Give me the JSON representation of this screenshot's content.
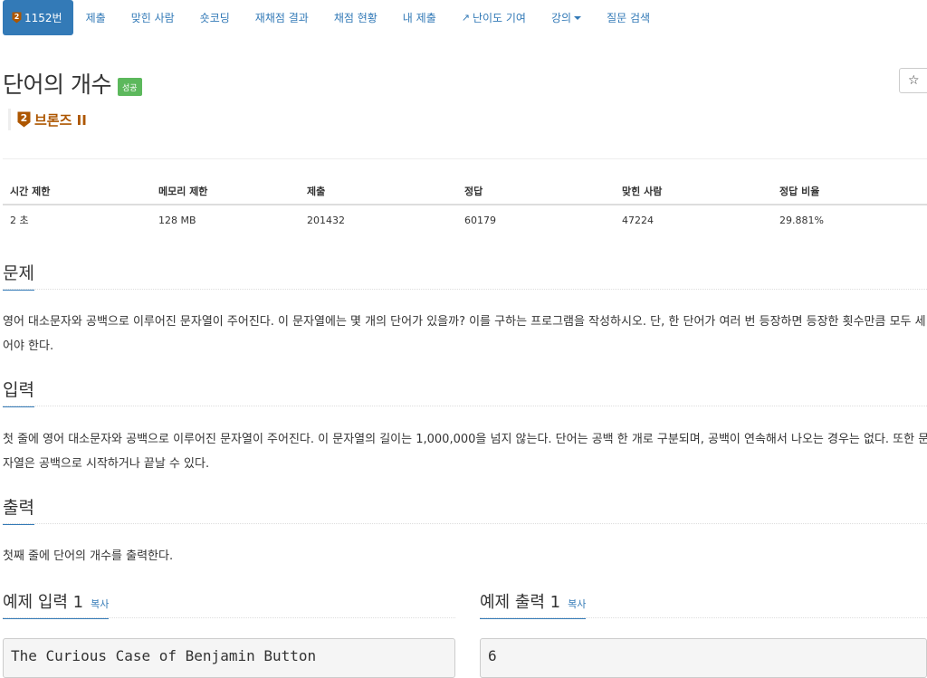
{
  "nav": {
    "tabs": [
      {
        "label": "1152번",
        "active": true
      },
      {
        "label": "제출"
      },
      {
        "label": "맞힌 사람"
      },
      {
        "label": "숏코딩"
      },
      {
        "label": "재채점 결과"
      },
      {
        "label": "채점 현황"
      },
      {
        "label": "내 제출"
      },
      {
        "label": "난이도 기여",
        "icon": "external-link-icon"
      },
      {
        "label": "강의",
        "dropdown": true
      },
      {
        "label": "질문 검색"
      }
    ]
  },
  "problem": {
    "title": "단어의 개수",
    "status_label": "성공",
    "star": "☆",
    "tier_number": "2",
    "tier_name": "브론즈 II"
  },
  "info_table": {
    "headers": [
      "시간 제한",
      "메모리 제한",
      "제출",
      "정답",
      "맞힌 사람",
      "정답 비율"
    ],
    "values": [
      "2 초",
      "128 MB",
      "201432",
      "60179",
      "47224",
      "29.881%"
    ]
  },
  "sections": {
    "problem_title": "문제",
    "problem_text": "영어 대소문자와 공백으로 이루어진 문자열이 주어진다. 이 문자열에는 몇 개의 단어가 있을까? 이를 구하는 프로그램을 작성하시오. 단, 한 단어가 여러 번 등장하면 등장한 횟수만큼 모두 세어야 한다.",
    "input_title": "입력",
    "input_text": "첫 줄에 영어 대소문자와 공백으로 이루어진 문자열이 주어진다. 이 문자열의 길이는 1,000,000을 넘지 않는다. 단어는 공백 한 개로 구분되며, 공백이 연속해서 나오는 경우는 없다. 또한 문자열은 공백으로 시작하거나 끝날 수 있다.",
    "output_title": "출력",
    "output_text": "첫째 줄에 단어의 개수를 출력한다."
  },
  "samples": {
    "input_title": "예제 입력 1",
    "output_title": "예제 출력 1",
    "copy_label": "복사",
    "input_value": "The Curious Case of Benjamin Button",
    "output_value": "6"
  },
  "colors": {
    "primary": "#337ab7",
    "success": "#5cb85c",
    "bronze": "#ad5600"
  }
}
